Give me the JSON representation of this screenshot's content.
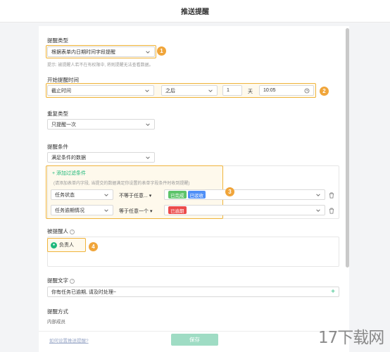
{
  "header": {
    "title": "推送提醒"
  },
  "remind_type": {
    "label": "提醒类型",
    "value": "根据表单内日期时间字段提醒",
    "hint": "提示: 被提醒人若不在有权限中, 将则提醒无法查看数据。"
  },
  "start_time": {
    "label": "开始提醒时间",
    "field": "截止时间",
    "relation": "之后",
    "amount": "1",
    "unit": "天",
    "time": "10:05"
  },
  "repeat": {
    "label": "重复类型",
    "value": "只提醒一次"
  },
  "condition": {
    "label": "提醒条件",
    "value": "满足条件的数据",
    "add_filter": "添加过滤条件",
    "add_hint": "(请添加表单内字段, 当提交的数据满足你设置的表单字段条件时收到提醒)",
    "rows": [
      {
        "field": "任务状态",
        "operator": "不等于任意...",
        "tags": [
          {
            "text": "已完成",
            "color": "#5cc46a"
          },
          {
            "text": "已驳收",
            "color": "#4f8ff7"
          }
        ]
      },
      {
        "field": "任务逾期情况",
        "operator": "等于任意一个",
        "tags": [
          {
            "text": "已逾期",
            "color": "#ec4b4b"
          }
        ]
      }
    ]
  },
  "recipients": {
    "label": "被提醒人",
    "chip": "负责人"
  },
  "message": {
    "label": "提醒文字",
    "value": "你有任务已逾期, 请及时处理~"
  },
  "method": {
    "label": "提醒方式",
    "sub": "内部成员"
  },
  "footer": {
    "link": "如何设置推送提醒?",
    "save": "保存"
  },
  "annotations": [
    "1",
    "2",
    "3",
    "4"
  ],
  "watermark": "17下载网",
  "colors": {
    "accent": "#f0a53a",
    "primary": "#1fb87a",
    "save_disabled": "#9fdcc4"
  }
}
